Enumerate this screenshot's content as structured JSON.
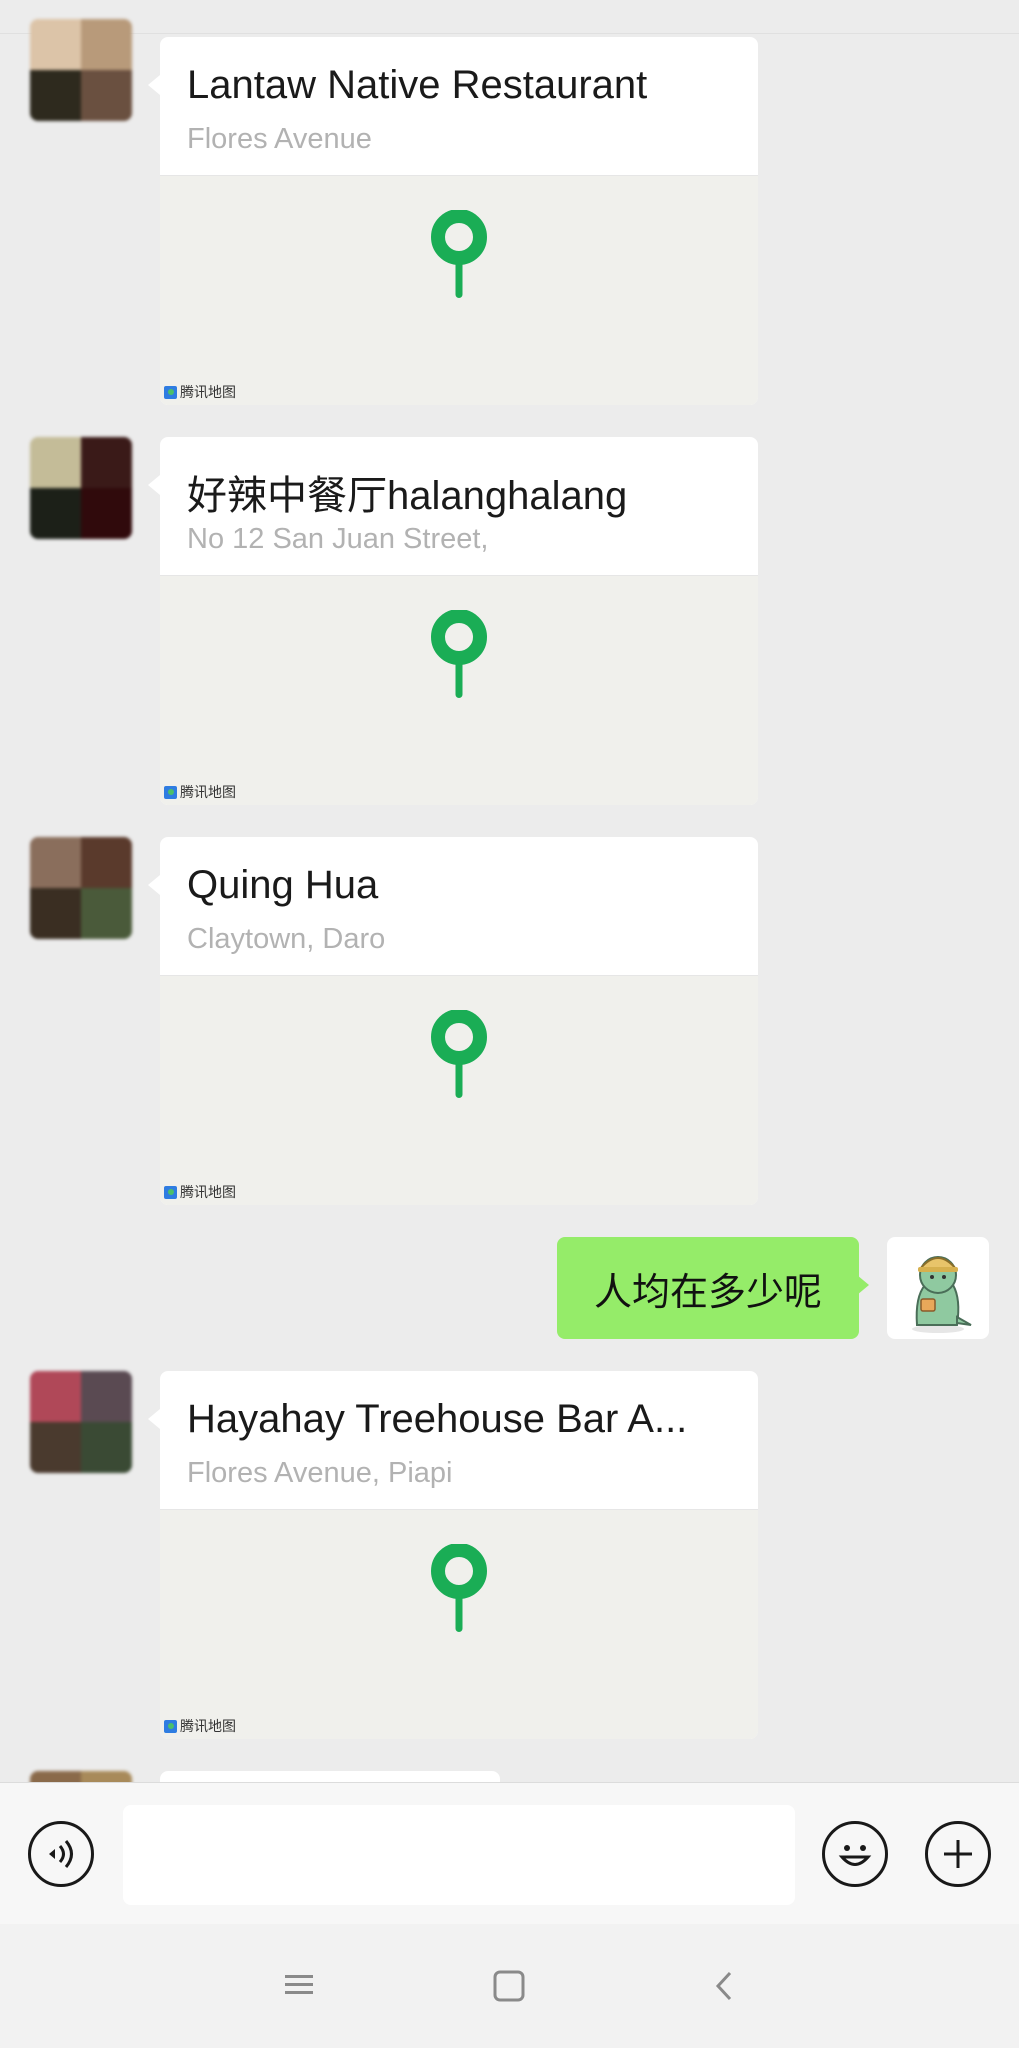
{
  "messages": [
    {
      "type": "location",
      "title": "Lantaw Native Restaurant",
      "address": "Flores Avenue",
      "map_brand": "腾讯地图"
    },
    {
      "type": "location",
      "title": "好辣中餐厅halanghalang",
      "address": "No 12 San Juan Street,",
      "map_brand": "腾讯地图"
    },
    {
      "type": "location",
      "title": "Quing Hua",
      "address": "Claytown, Daro",
      "map_brand": "腾讯地图"
    },
    {
      "type": "text",
      "from": "me",
      "text": "人均在多少呢"
    },
    {
      "type": "location",
      "title": "Hayahay Treehouse Bar A...",
      "address": "Flores Avenue, Piapi",
      "map_brand": "腾讯地图"
    }
  ],
  "colors": {
    "pin": "#1aad55",
    "my_bubble": "#95ec69",
    "background": "#ececec"
  },
  "icons": {
    "voice": "voice-input-icon",
    "emoji": "emoji-icon",
    "more": "plus-icon",
    "nav_menu": "menu-icon",
    "nav_home": "home-icon",
    "nav_back": "back-icon"
  }
}
